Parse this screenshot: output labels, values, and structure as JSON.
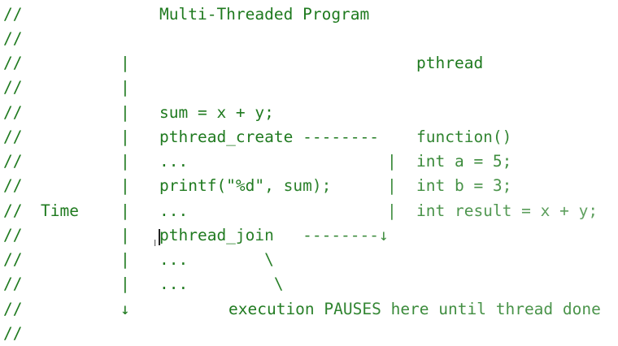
{
  "colors": {
    "comment": "#1f7a1f",
    "background": "#ffffff",
    "cursor": "#222222"
  },
  "lines": [
    {
      "prefix": "//",
      "col1": "",
      "col2": "",
      "col3": "Multi-Threaded Program",
      "col4": "",
      "col5": ""
    },
    {
      "prefix": "//",
      "col1": "",
      "col2": "",
      "col3": "",
      "col4": "",
      "col5": ""
    },
    {
      "prefix": "//",
      "col1": "",
      "col2": "|",
      "col3": "",
      "col4": "",
      "col5": "pthread"
    },
    {
      "prefix": "//",
      "col1": "",
      "col2": "|",
      "col3": "",
      "col4": "",
      "col5": ""
    },
    {
      "prefix": "//",
      "col1": "",
      "col2": "|",
      "col3": "sum = x + y;",
      "col4": "",
      "col5": ""
    },
    {
      "prefix": "//",
      "col1": "",
      "col2": "|",
      "col3": "pthread_create --------",
      "col4": "",
      "col5": "function()"
    },
    {
      "prefix": "//",
      "col1": "",
      "col2": "|",
      "col3": "...",
      "col4": "|",
      "col5": "int a = 5;"
    },
    {
      "prefix": "//",
      "col1": "",
      "col2": "|",
      "col3": "printf(\"%d\", sum);",
      "col4": "|",
      "col5": "int b = 3;"
    },
    {
      "prefix": "//",
      "col1": "Time",
      "col2": "|",
      "col3": "...",
      "col4": "|",
      "col5": "int result = x + y;"
    },
    {
      "prefix": "//",
      "col1": "",
      "col2": "|",
      "col3": "pthread_join   --------↓",
      "col4": "",
      "col5": ""
    },
    {
      "prefix": "//",
      "col1": "",
      "col2": "|",
      "col3": "...        \\",
      "col4": "",
      "col5": ""
    },
    {
      "prefix": "//",
      "col1": "",
      "col2": "|",
      "col3": "...         \\",
      "col4": "",
      "col5": ""
    },
    {
      "prefix": "//",
      "col1": "",
      "col2": "↓",
      "col3": "",
      "col4": "",
      "col5": ""
    },
    {
      "prefix": "//",
      "col1": "",
      "col2": "",
      "col3": "",
      "col4": "",
      "col5": ""
    }
  ],
  "note_line": {
    "text": "execution PAUSES here until thread done"
  }
}
